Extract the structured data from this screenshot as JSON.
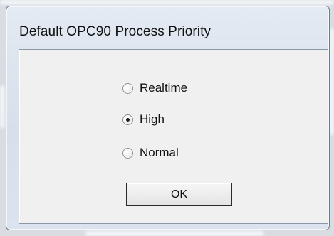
{
  "dialog": {
    "title": "Default OPC90 Process Priority"
  },
  "priority_options": [
    {
      "label": "Realtime",
      "selected": false
    },
    {
      "label": "High",
      "selected": true
    },
    {
      "label": "Normal",
      "selected": false
    }
  ],
  "buttons": {
    "ok_label": "OK"
  }
}
